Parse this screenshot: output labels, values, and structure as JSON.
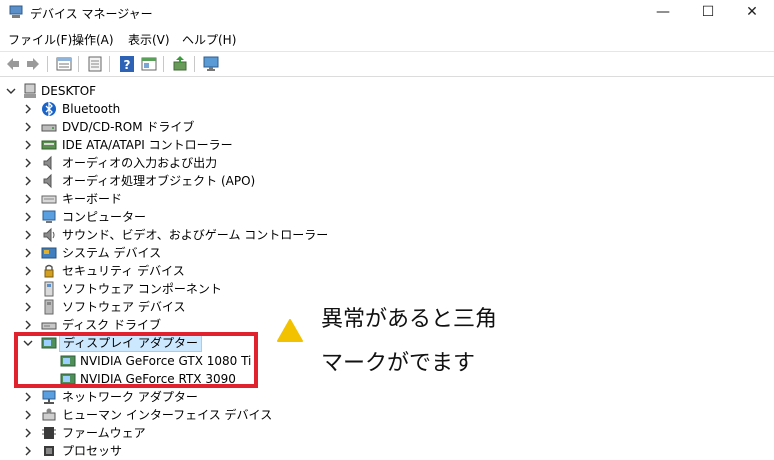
{
  "window": {
    "title": "デバイス マネージャー",
    "minimize_glyph": "—",
    "maximize_glyph": "☐",
    "close_glyph": "✕"
  },
  "menu": [
    "ファイル(F)",
    "操作(A)",
    "表示(V)",
    "ヘルプ(H)"
  ],
  "toolbar": [
    "back-icon",
    "forward-icon",
    "properties-icon",
    "show-hidden-icon",
    "help-icon",
    "view-icon",
    "update-driver-icon",
    "monitor-icon"
  ],
  "tree": {
    "root": "DESKTOF",
    "categories": [
      {
        "label": "Bluetooth",
        "icon": "bluetooth-icon",
        "expanded": false
      },
      {
        "label": "DVD/CD-ROM ドライブ",
        "icon": "dvd-drive-icon",
        "expanded": false
      },
      {
        "label": "IDE ATA/ATAPI コントローラー",
        "icon": "ide-controller-icon",
        "expanded": false
      },
      {
        "label": "オーディオの入力および出力",
        "icon": "speaker-icon",
        "expanded": false
      },
      {
        "label": "オーディオ処理オブジェクト (APO)",
        "icon": "speaker-icon",
        "expanded": false
      },
      {
        "label": "キーボード",
        "icon": "keyboard-icon",
        "expanded": false
      },
      {
        "label": "コンピューター",
        "icon": "computer-icon",
        "expanded": false
      },
      {
        "label": "サウンド、ビデオ、およびゲーム コントローラー",
        "icon": "sound-icon",
        "expanded": false
      },
      {
        "label": "システム デバイス",
        "icon": "system-device-icon",
        "expanded": false
      },
      {
        "label": "セキュリティ デバイス",
        "icon": "security-device-icon",
        "expanded": false
      },
      {
        "label": "ソフトウェア コンポーネント",
        "icon": "software-component-icon",
        "expanded": false
      },
      {
        "label": "ソフトウェア デバイス",
        "icon": "software-device-icon",
        "expanded": false
      },
      {
        "label": "ディスク ドライブ",
        "icon": "disk-drive-icon",
        "expanded": false
      },
      {
        "label": "ディスプレイ アダプター",
        "icon": "display-adapter-icon",
        "expanded": true,
        "selected": true,
        "children": [
          "NVIDIA GeForce GTX 1080 Ti",
          "NVIDIA GeForce RTX 3090"
        ]
      },
      {
        "label": "ネットワーク アダプター",
        "icon": "network-adapter-icon",
        "expanded": false
      },
      {
        "label": "ヒューマン インターフェイス デバイス",
        "icon": "hid-icon",
        "expanded": false
      },
      {
        "label": "ファームウェア",
        "icon": "firmware-icon",
        "expanded": false
      },
      {
        "label": "プロセッサ",
        "icon": "processor-icon",
        "expanded": false
      }
    ]
  },
  "annotation": {
    "line1": "異常があると三角",
    "line2": "マークがでます",
    "highlight_color": "#e0222e",
    "warning_color": "#f2c200"
  }
}
